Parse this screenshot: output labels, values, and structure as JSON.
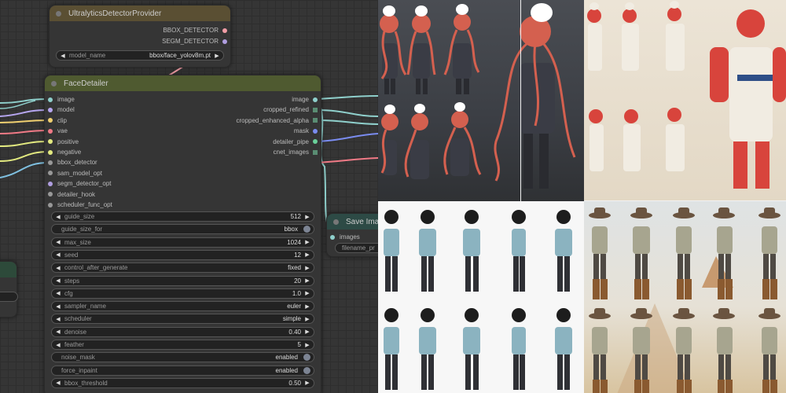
{
  "provider_node": {
    "title": "UltralyticsDetectorProvider",
    "outputs": [
      "BBOX_DETECTOR",
      "SEGM_DETECTOR"
    ],
    "model_name_label": "model_name",
    "model_name_value": "bbox/face_yolov8m.pt"
  },
  "facedetailer_node": {
    "title": "FaceDetailer",
    "inputs": [
      "image",
      "model",
      "clip",
      "vae",
      "positive",
      "negative",
      "bbox_detector",
      "sam_model_opt",
      "segm_detector_opt",
      "detailer_hook",
      "scheduler_func_opt"
    ],
    "outputs": [
      "image",
      "cropped_refined",
      "cropped_enhanced_alpha",
      "mask",
      "detailer_pipe",
      "cnet_images"
    ],
    "widgets": [
      {
        "label": "guide_size",
        "value": "512"
      },
      {
        "label": "guide_size_for",
        "value": "bbox"
      },
      {
        "label": "max_size",
        "value": "1024"
      },
      {
        "label": "seed",
        "value": "12"
      },
      {
        "label": "control_after_generate",
        "value": "fixed"
      },
      {
        "label": "steps",
        "value": "20"
      },
      {
        "label": "cfg",
        "value": "1.0"
      },
      {
        "label": "sampler_name",
        "value": "euler"
      },
      {
        "label": "scheduler",
        "value": "simple"
      },
      {
        "label": "denoise",
        "value": "0.40"
      },
      {
        "label": "feather",
        "value": "5"
      },
      {
        "label": "noise_mask",
        "value": "enabled"
      },
      {
        "label": "force_inpaint",
        "value": "enabled"
      },
      {
        "label": "bbox_threshold",
        "value": "0.50"
      }
    ]
  },
  "save_node": {
    "title": "Save Imag",
    "input": "images",
    "filename_label": "filename_pr"
  },
  "colors": {
    "provider_title": "#5a4f33",
    "facedetailer_title": "#4f5a30",
    "save_title": "#2d4a45",
    "partial_title": "#2d4a3a"
  }
}
